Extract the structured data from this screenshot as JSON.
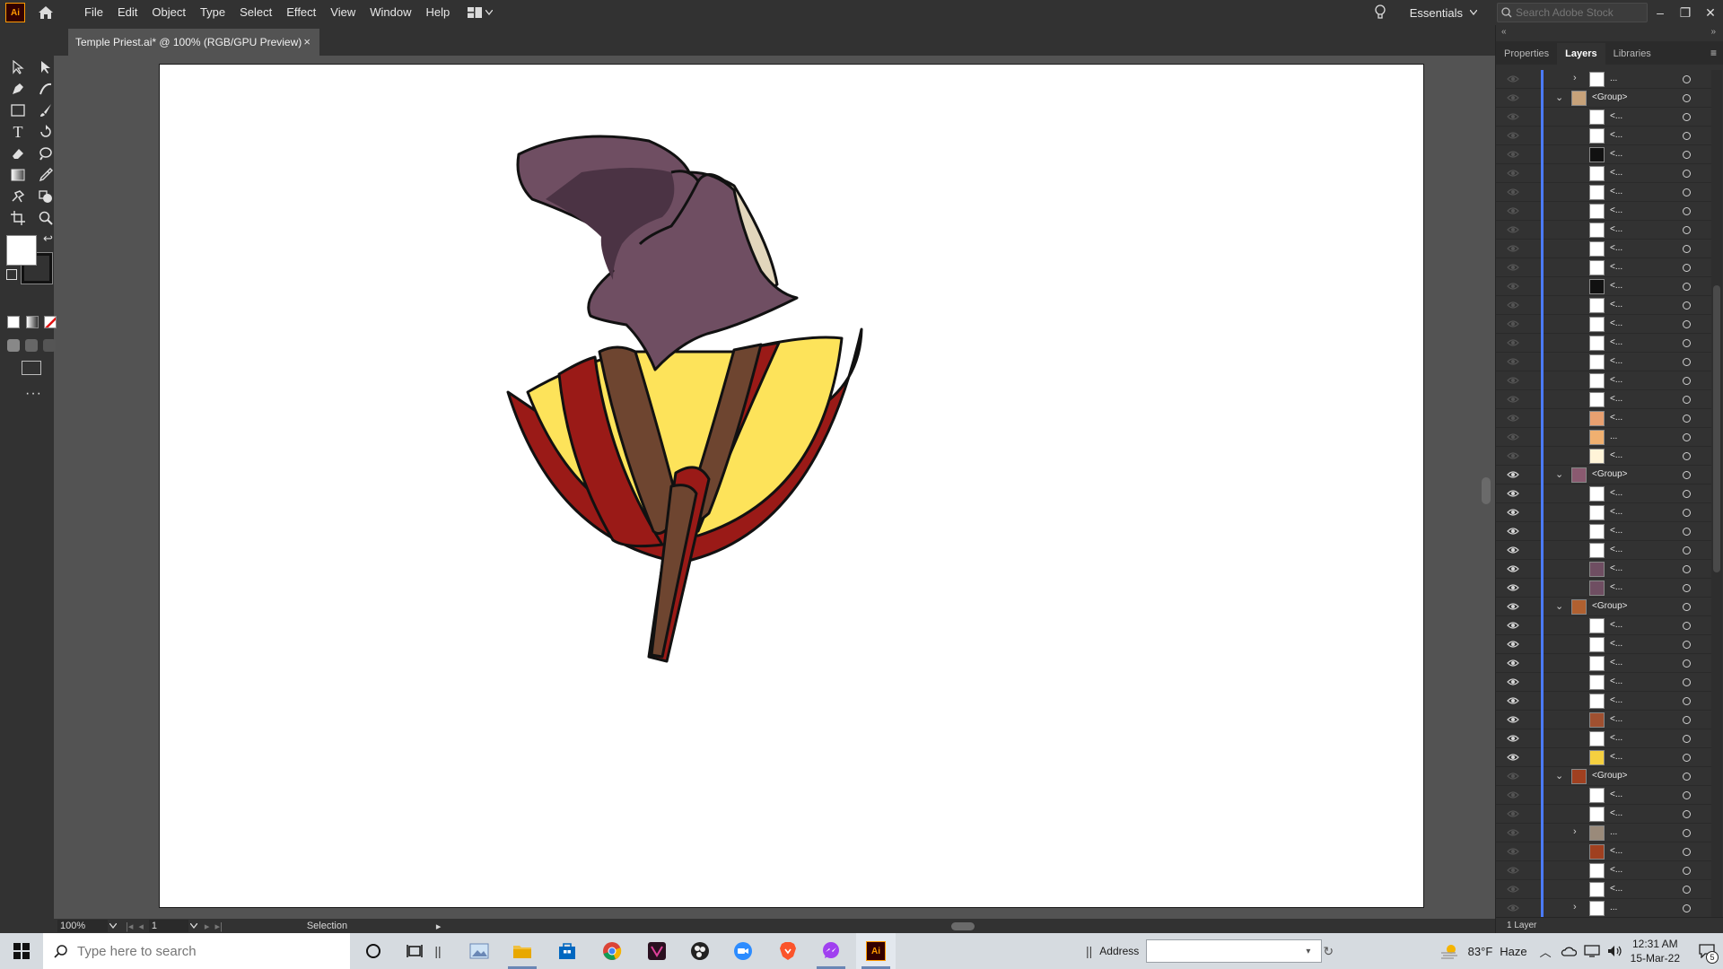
{
  "app": {
    "logo": "Ai",
    "menus": [
      "File",
      "Edit",
      "Object",
      "Type",
      "Select",
      "Effect",
      "View",
      "Window",
      "Help"
    ],
    "workspace": "Essentials",
    "stock_search_placeholder": "Search Adobe Stock"
  },
  "document": {
    "tab_title": "Temple Priest.ai* @ 100% (RGB/GPU Preview)",
    "close_glyph": "×"
  },
  "status": {
    "zoom": "100%",
    "artboard_number": "1",
    "current_tool": "Selection"
  },
  "panel": {
    "tabs": [
      "Properties",
      "Layers",
      "Libraries"
    ],
    "active_tab": "Layers",
    "footer": "1 Layer",
    "layers": [
      {
        "depth": 2,
        "twist": "right",
        "name": "...",
        "visible": false,
        "thumb": "#ffffff"
      },
      {
        "depth": 1,
        "twist": "down",
        "name": "<Group>",
        "visible": false,
        "thumb": "#c7a27a"
      },
      {
        "depth": 2,
        "name": "<...",
        "visible": false,
        "thumb": "#ffffff"
      },
      {
        "depth": 2,
        "name": "<...",
        "visible": false,
        "thumb": "#ffffff"
      },
      {
        "depth": 2,
        "name": "<...",
        "visible": false,
        "thumb": "#111111"
      },
      {
        "depth": 2,
        "name": "<...",
        "visible": false,
        "thumb": "#ffffff"
      },
      {
        "depth": 2,
        "name": "<...",
        "visible": false,
        "thumb": "#ffffff"
      },
      {
        "depth": 2,
        "name": "<...",
        "visible": false,
        "thumb": "#ffffff"
      },
      {
        "depth": 2,
        "name": "<...",
        "visible": false,
        "thumb": "#ffffff"
      },
      {
        "depth": 2,
        "name": "<...",
        "visible": false,
        "thumb": "#ffffff"
      },
      {
        "depth": 2,
        "name": "<...",
        "visible": false,
        "thumb": "#ffffff"
      },
      {
        "depth": 2,
        "name": "<...",
        "visible": false,
        "thumb": "#111111"
      },
      {
        "depth": 2,
        "name": "<...",
        "visible": false,
        "thumb": "#ffffff"
      },
      {
        "depth": 2,
        "name": "<...",
        "visible": false,
        "thumb": "#ffffff"
      },
      {
        "depth": 2,
        "name": "<...",
        "visible": false,
        "thumb": "#ffffff"
      },
      {
        "depth": 2,
        "name": "<...",
        "visible": false,
        "thumb": "#ffffff"
      },
      {
        "depth": 2,
        "name": "<...",
        "visible": false,
        "thumb": "#ffffff"
      },
      {
        "depth": 2,
        "name": "<...",
        "visible": false,
        "thumb": "#ffffff"
      },
      {
        "depth": 2,
        "name": "<...",
        "visible": false,
        "thumb": "#e8a070"
      },
      {
        "depth": 2,
        "name": "...",
        "visible": false,
        "thumb": "#f0b070"
      },
      {
        "depth": 2,
        "name": "<...",
        "visible": false,
        "thumb": "#fff4d8"
      },
      {
        "depth": 1,
        "twist": "down",
        "name": "<Group>",
        "visible": true,
        "thumb": "#8a5a70"
      },
      {
        "depth": 2,
        "name": "<...",
        "visible": true,
        "thumb": "#ffffff"
      },
      {
        "depth": 2,
        "name": "<...",
        "visible": true,
        "thumb": "#ffffff"
      },
      {
        "depth": 2,
        "name": "<...",
        "visible": true,
        "thumb": "#ffffff"
      },
      {
        "depth": 2,
        "name": "<...",
        "visible": true,
        "thumb": "#ffffff"
      },
      {
        "depth": 2,
        "name": "<...",
        "visible": true,
        "thumb": "#6f4e62"
      },
      {
        "depth": 2,
        "name": "<...",
        "visible": true,
        "thumb": "#6f4e62"
      },
      {
        "depth": 1,
        "twist": "down",
        "name": "<Group>",
        "visible": true,
        "thumb": "#b06030"
      },
      {
        "depth": 2,
        "name": "<...",
        "visible": true,
        "thumb": "#ffffff"
      },
      {
        "depth": 2,
        "name": "<...",
        "visible": true,
        "thumb": "#ffffff"
      },
      {
        "depth": 2,
        "name": "<...",
        "visible": true,
        "thumb": "#ffffff"
      },
      {
        "depth": 2,
        "name": "<...",
        "visible": true,
        "thumb": "#ffffff"
      },
      {
        "depth": 2,
        "name": "<...",
        "visible": true,
        "thumb": "#ffffff"
      },
      {
        "depth": 2,
        "name": "<...",
        "visible": true,
        "thumb": "#a05030"
      },
      {
        "depth": 2,
        "name": "<...",
        "visible": true,
        "thumb": "#ffffff"
      },
      {
        "depth": 2,
        "name": "<...",
        "visible": true,
        "thumb": "#f5d040"
      },
      {
        "depth": 1,
        "twist": "down",
        "name": "<Group>",
        "visible": false,
        "thumb": "#a04020"
      },
      {
        "depth": 2,
        "name": "<...",
        "visible": false,
        "thumb": "#ffffff"
      },
      {
        "depth": 2,
        "name": "<...",
        "visible": false,
        "thumb": "#ffffff"
      },
      {
        "depth": 2,
        "twist": "right",
        "name": "...",
        "visible": false,
        "thumb": "#9a8a7a"
      },
      {
        "depth": 2,
        "name": "<...",
        "visible": false,
        "thumb": "#a04020"
      },
      {
        "depth": 2,
        "name": "<...",
        "visible": false,
        "thumb": "#ffffff"
      },
      {
        "depth": 2,
        "name": "<...",
        "visible": false,
        "thumb": "#ffffff"
      },
      {
        "depth": 2,
        "twist": "right",
        "name": "...",
        "visible": false,
        "thumb": "#ffffff"
      }
    ]
  },
  "colors": {
    "hood": "#6f4e62",
    "hood_shadow": "#4b3344",
    "hood_lining": "#e2d6bc",
    "robe_red": "#9a1a17",
    "robe_yellow": "#fde35a",
    "stole_brown": "#6e4530",
    "outline": "#111111",
    "layer_stripe": "#4b7bff"
  },
  "taskbar": {
    "search_placeholder": "Type here to search",
    "address_label": "Address",
    "weather_temp": "83°F",
    "weather_text": "Haze",
    "time": "12:31 AM",
    "date": "15-Mar-22",
    "notification_count": "5"
  }
}
